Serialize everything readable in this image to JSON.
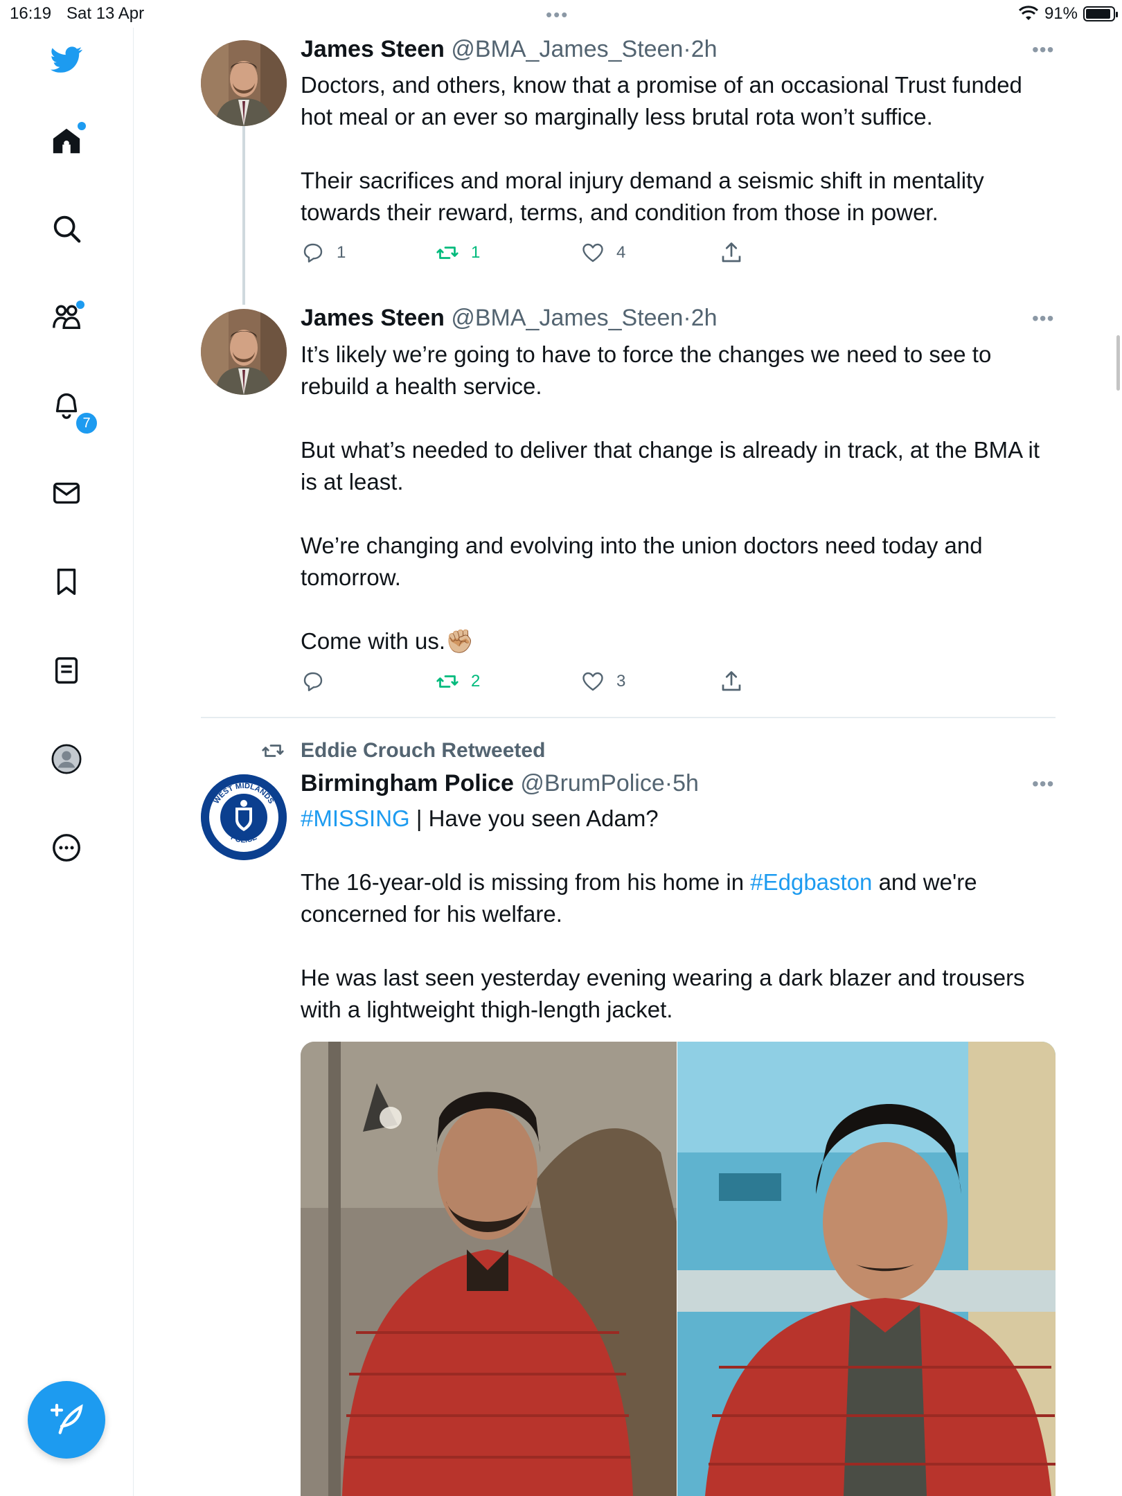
{
  "status_bar": {
    "time": "16:19",
    "date": "Sat 13 Apr",
    "battery": "91%",
    "battery_level": 0.91
  },
  "sidebar": {
    "notification_count": "7",
    "items": [
      "twitter-logo",
      "home",
      "search",
      "communities",
      "notifications",
      "messages",
      "bookmarks",
      "lists",
      "profile",
      "more"
    ]
  },
  "tweets": [
    {
      "name": "James Steen",
      "handle": "@BMA_James_Steen",
      "sep": "·",
      "time": "2h",
      "paragraphs": [
        "Doctors, and others, know that a promise of an occasional Trust funded hot meal or an ever so marginally less brutal rota won’t suffice.",
        "Their sacrifices and moral injury demand a seismic shift in mentality towards their reward, terms, and condition from those in power."
      ],
      "replies": "1",
      "retweets": "1",
      "likes": "4"
    },
    {
      "name": "James Steen",
      "handle": "@BMA_James_Steen",
      "sep": "·",
      "time": "2h",
      "paragraphs": [
        "It’s likely we’re going to have to force the changes we need to see to rebuild a health service.",
        "But what’s needed to deliver that change is already in track, at the BMA it is at least.",
        "We’re changing and evolving into the union doctors need today and tomorrow.",
        "Come with us.✊🏼"
      ],
      "replies": "",
      "retweets": "2",
      "likes": "3"
    },
    {
      "retweeted_by": "Eddie Crouch Retweeted",
      "name": "Birmingham Police",
      "handle": "@BrumPolice",
      "sep": "·",
      "time": "5h",
      "hashtag_missing": "#MISSING",
      "line1_rest": " | Have you seen Adam?",
      "line2_start": "The 16-year-old is missing from his home in ",
      "hashtag_edgbaston": "#Edgbaston",
      "line2_end": " and we're concerned for his welfare.",
      "line3": "He was last seen yesterday evening wearing a dark blazer and trousers with a lightweight thigh-length jacket.",
      "logo_text_top": "WEST MIDLANDS",
      "logo_text_bottom": "POLICE"
    }
  ],
  "colors": {
    "accent": "#1d9bf0",
    "retweet": "#00ba7c",
    "muted": "#536471",
    "jacket": "#b8342c"
  }
}
